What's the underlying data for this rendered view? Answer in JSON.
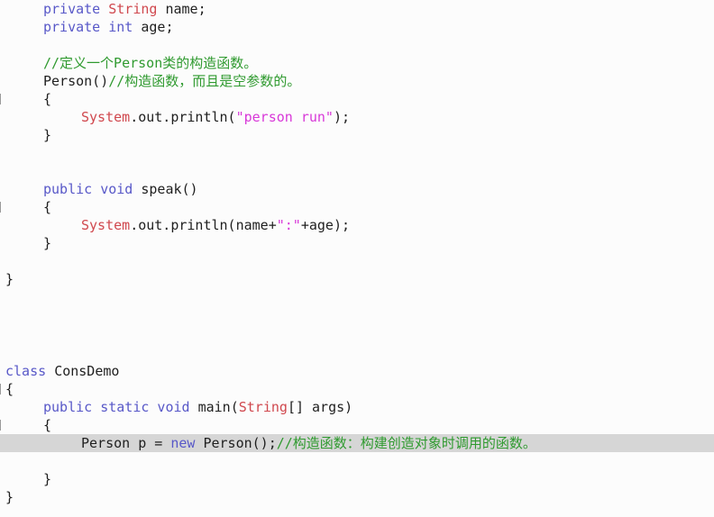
{
  "editor": {
    "lines": [
      {
        "tokens": [
          {
            "t": "private ",
            "c": "kw"
          },
          {
            "t": "String ",
            "c": "ty"
          },
          {
            "t": "name;",
            "c": ""
          }
        ]
      },
      {
        "tokens": [
          {
            "t": "private int ",
            "c": "kw"
          },
          {
            "t": "age;",
            "c": ""
          }
        ]
      },
      {
        "tokens": []
      },
      {
        "tokens": [
          {
            "t": "//定义一个Person类的构造函数。",
            "c": "cm"
          }
        ]
      },
      {
        "tokens": [
          {
            "t": "Person()",
            "c": ""
          },
          {
            "t": "//构造函数，而且是空参数的。",
            "c": "cm"
          }
        ]
      },
      {
        "tokens": [
          {
            "t": "{",
            "c": ""
          }
        ],
        "gutter": true
      },
      {
        "tokens": [
          {
            "t": "System",
            "c": "ty"
          },
          {
            "t": ".out.println(",
            "c": ""
          },
          {
            "t": "\"person run\"",
            "c": "str"
          },
          {
            "t": ");",
            "c": ""
          }
        ]
      },
      {
        "tokens": [
          {
            "t": "}",
            "c": ""
          }
        ]
      },
      {
        "tokens": []
      },
      {
        "tokens": []
      },
      {
        "tokens": [
          {
            "t": "public void ",
            "c": "kw"
          },
          {
            "t": "speak()",
            "c": ""
          }
        ]
      },
      {
        "tokens": [
          {
            "t": "{",
            "c": ""
          }
        ],
        "gutter": true
      },
      {
        "tokens": [
          {
            "t": "System",
            "c": "ty"
          },
          {
            "t": ".out.println(name+",
            "c": ""
          },
          {
            "t": "\":\"",
            "c": "str"
          },
          {
            "t": "+age);",
            "c": ""
          }
        ]
      },
      {
        "tokens": [
          {
            "t": "}",
            "c": ""
          }
        ]
      },
      {
        "tokens": []
      },
      {
        "tokens": [
          {
            "t": "}",
            "c": ""
          }
        ]
      },
      {
        "tokens": []
      },
      {
        "tokens": []
      },
      {
        "tokens": []
      },
      {
        "tokens": []
      },
      {
        "tokens": [
          {
            "t": "class ",
            "c": "kw"
          },
          {
            "t": "ConsDemo",
            "c": ""
          }
        ]
      },
      {
        "tokens": [
          {
            "t": "{",
            "c": ""
          }
        ],
        "gutter": true
      },
      {
        "tokens": [
          {
            "t": "public static void ",
            "c": "kw"
          },
          {
            "t": "main(",
            "c": ""
          },
          {
            "t": "String",
            "c": "ty"
          },
          {
            "t": "[] args)",
            "c": ""
          }
        ]
      },
      {
        "tokens": [
          {
            "t": "{",
            "c": ""
          }
        ],
        "gutter": true
      },
      {
        "tokens": [
          {
            "t": "Person p = ",
            "c": ""
          },
          {
            "t": "new ",
            "c": "kw"
          },
          {
            "t": "Person();",
            "c": ""
          },
          {
            "t": "//构造函数：构建创造对象时调用的函数。",
            "c": "cm"
          }
        ],
        "highlight": true
      },
      {
        "tokens": []
      },
      {
        "tokens": [
          {
            "t": "}",
            "c": ""
          }
        ]
      },
      {
        "tokens": [
          {
            "t": "}",
            "c": ""
          }
        ]
      }
    ]
  }
}
